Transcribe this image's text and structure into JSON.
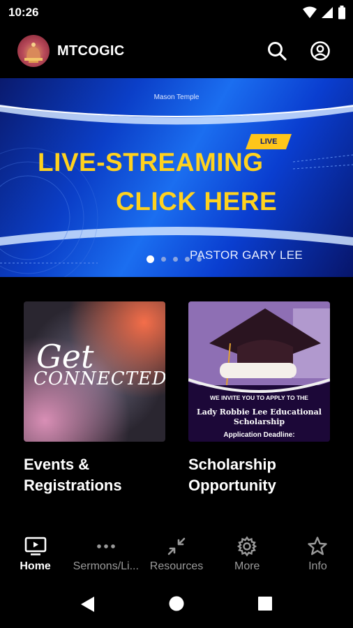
{
  "status_bar": {
    "time": "10:26",
    "icons": [
      "wifi-icon",
      "cell-signal-icon",
      "battery-icon"
    ]
  },
  "app_bar": {
    "title": "MTCOGIC",
    "actions": [
      "search-icon",
      "account-icon"
    ]
  },
  "banner": {
    "top_text": "Mason Temple",
    "badge": "LIVE",
    "line1": "LIVE-STREAMING",
    "line2": "CLICK HERE",
    "pastor": "PASTOR GARY LEE",
    "slide_count": 5,
    "active_slide": 1
  },
  "cards": [
    {
      "image_text_1": "Get",
      "image_text_2": "CONNECTED",
      "title_line1": "Events &",
      "title_line2": "Registrations"
    },
    {
      "image_text_1": "WE INVITE YOU TO APPLY TO THE",
      "image_text_2": "Lady Robbie Lee Educational",
      "image_text_3": "Scholarship",
      "image_text_4": "Application Deadline:",
      "title_line1": "Scholarship",
      "title_line2": "Opportunity"
    }
  ],
  "bottom_nav": [
    {
      "label": "Home",
      "icon": "tv-icon",
      "active": true
    },
    {
      "label": "Sermons/Li...",
      "icon": "more-horizontal-icon",
      "active": false
    },
    {
      "label": "Resources",
      "icon": "collapse-arrows-icon",
      "active": false
    },
    {
      "label": "More",
      "icon": "gear-icon",
      "active": false
    },
    {
      "label": "Info",
      "icon": "star-icon",
      "active": false
    }
  ],
  "colors": {
    "accent": "#ffd21f",
    "background": "#000000",
    "banner": "#0b3fc8",
    "inactive": "#9a9a9a"
  }
}
